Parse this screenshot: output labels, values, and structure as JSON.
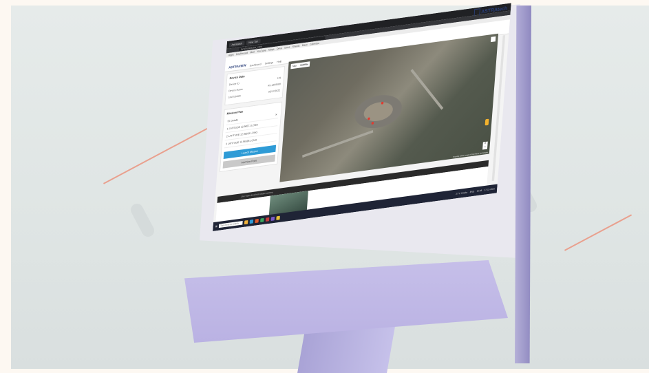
{
  "browser": {
    "tabs": [
      "Astradash",
      "New Tab"
    ],
    "url": "localhost/astra_view",
    "bookmarks": [
      "Apps",
      "Dashboard",
      "Mail",
      "YouTube",
      "Maps",
      "Drive",
      "Docs",
      "Sheets",
      "Meet",
      "Calendar"
    ]
  },
  "brand": {
    "name": "ASTRAtech"
  },
  "app": {
    "logo": "ASTRAVIEW",
    "nav": [
      "Dashboard",
      "Settings",
      "Help"
    ]
  },
  "device_card": {
    "title": "Device Data",
    "rows": [
      {
        "key": "Device ID",
        "value": "101"
      },
      {
        "key": "Device Name",
        "value": "AV-1209480"
      },
      {
        "key": "Last Update",
        "value": "05/17/2022"
      }
    ]
  },
  "mission_card": {
    "title": "Mission Plan",
    "header_label": "Sl. Details",
    "rows": [
      "1 LATITUDE 12.96571 LONG",
      "2 LATITUDE 12.96581 LONG",
      "3 LATITUDE 12.96595 LONG"
    ],
    "primary_button": "Launch Mission",
    "secondary_button": "Add New Point"
  },
  "map": {
    "type_options": [
      "Map",
      "Satellite"
    ],
    "active_type": "Satellite",
    "labels": [
      "Labels"
    ],
    "attribution": "Map data ©2022 Imagery ©2022 Maxar Technologies"
  },
  "video": {
    "bar_text": "Live video feed from drone camera"
  },
  "taskbar": {
    "search_placeholder": "Type here to search",
    "weather": "27°C Smoke",
    "time": "15:08",
    "date": "17-11-2022",
    "lang": "ENG"
  },
  "colors": {
    "accent": "#2e9bd6",
    "monitor": "#c6bfe9",
    "map_pin": "#e03a2f"
  }
}
